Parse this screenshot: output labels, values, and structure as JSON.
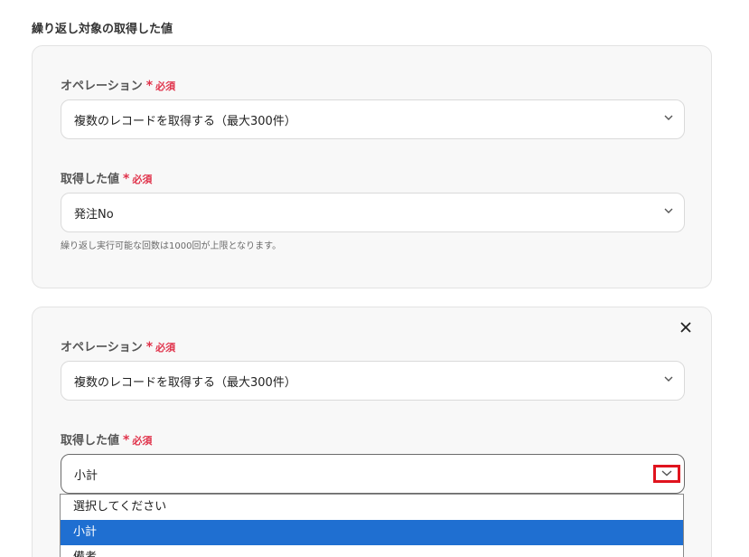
{
  "section": {
    "title": "繰り返し対象の取得した値"
  },
  "required": {
    "star": "*",
    "text": "必須"
  },
  "card1": {
    "operation_label": "オペレーション",
    "operation_value": "複数のレコードを取得する（最大300件）",
    "value_label": "取得した値",
    "value_value": "発注No",
    "hint": "繰り返し実行可能な回数は1000回が上限となります。"
  },
  "card2": {
    "operation_label": "オペレーション",
    "operation_value": "複数のレコードを取得する（最大300件）",
    "value_label": "取得した値",
    "value_value": "小計",
    "close_icon": "close-icon"
  },
  "dropdown": {
    "options": [
      "選択してください",
      "小計",
      "備考"
    ],
    "selected_index": 1
  },
  "colors": {
    "required": "#e0334b",
    "highlight_box": "#e0141e",
    "selected_option": "#1f6fd1"
  }
}
